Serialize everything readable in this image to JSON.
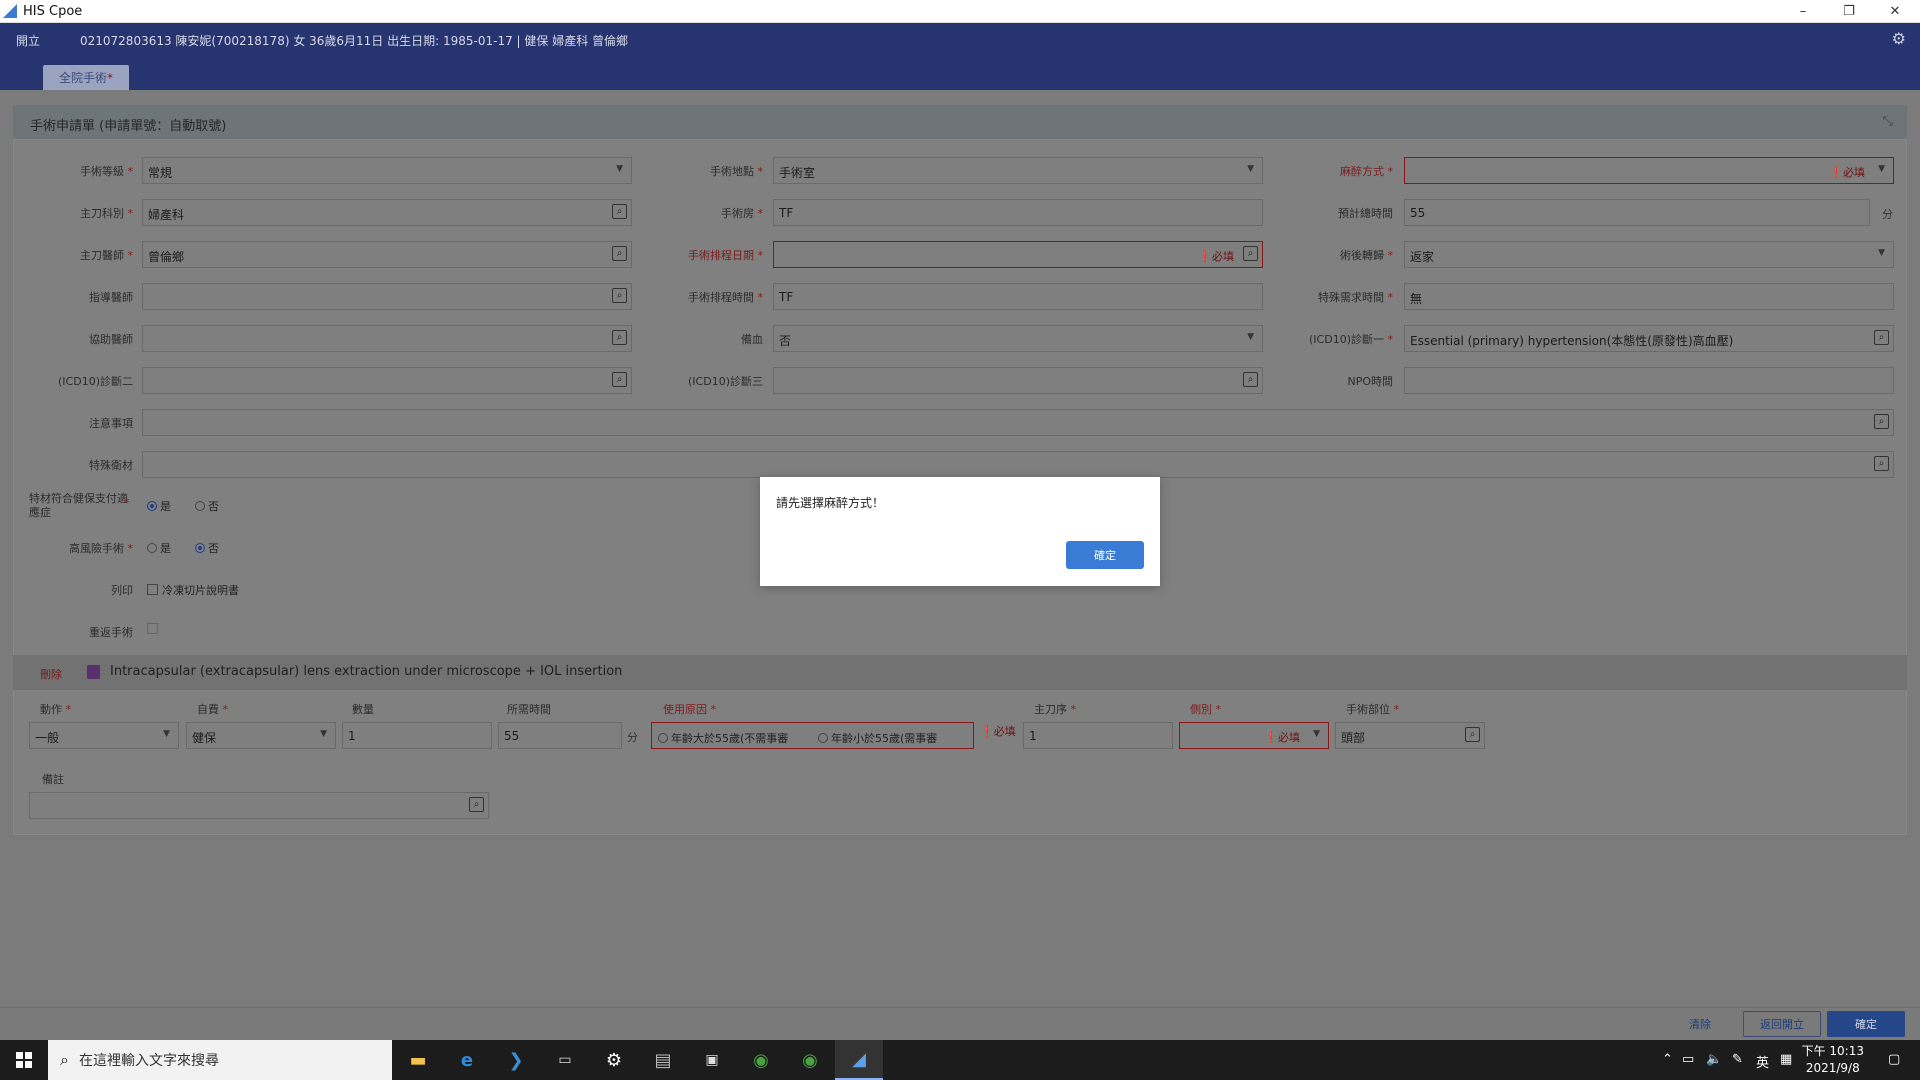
{
  "window": {
    "title": "HIS Cpoe",
    "minimize": "–",
    "restore": "❐",
    "close": "✕"
  },
  "header": {
    "open_btn": "開立",
    "patient_info": "021072803613  陳安妮(700218178)  女  36歲6月11日  出生日期: 1985-01-17  |  健保  婦產科  曾倫鄉",
    "tab_label": "全院手術",
    "tab_mark": "*"
  },
  "panel": {
    "title": "手術申請單 (申請單號：自動取號)",
    "must": "必填",
    "fields": {
      "grade": {
        "label": "手術等級",
        "value": "常規"
      },
      "place": {
        "label": "手術地點",
        "value": "手術室"
      },
      "anesthesia": {
        "label": "麻醉方式",
        "value": ""
      },
      "dept": {
        "label": "主刀科別",
        "value": "婦產科"
      },
      "room": {
        "label": "手術房",
        "value": "TF"
      },
      "est_time": {
        "label": "預計總時間",
        "value": "55",
        "unit": "分"
      },
      "doctor": {
        "label": "主刀醫師",
        "value": "曾倫鄉"
      },
      "sched_date": {
        "label": "手術排程日期",
        "value": ""
      },
      "postop": {
        "label": "術後轉歸",
        "value": "返家"
      },
      "assist1": {
        "label": "指導醫師",
        "value": ""
      },
      "sched_time": {
        "label": "手術排程時間",
        "value": "TF"
      },
      "special_time": {
        "label": "特殊需求時間",
        "value": "無"
      },
      "assist2": {
        "label": "協助醫師",
        "value": ""
      },
      "blood": {
        "label": "備血",
        "value": "否"
      },
      "icd1": {
        "label": "(ICD10)診斷一",
        "value": "Essential (primary) hypertension(本態性(原發性)高血壓)"
      },
      "icd2": {
        "label": "(ICD10)診斷二",
        "value": ""
      },
      "icd3": {
        "label": "(ICD10)診斷三",
        "value": ""
      },
      "npo": {
        "label": "NPO時間",
        "value": ""
      },
      "notes": {
        "label": "注意事項",
        "value": ""
      },
      "material": {
        "label": "特殊衛材",
        "value": ""
      },
      "insurance": {
        "label": "特材符合健保支付適應症",
        "yes": "是",
        "no": "否"
      },
      "high_risk": {
        "label": "高風險手術",
        "yes": "是",
        "no": "否"
      },
      "print": {
        "label": "列印",
        "option": "冷凍切片說明書"
      },
      "redo": {
        "label": "重返手術"
      }
    }
  },
  "procedure": {
    "delete": "刪除",
    "name": "Intracapsular (extracapsular) lens extraction under microscope + IOL insertion",
    "cols": {
      "action": {
        "label": "動作",
        "value": "一般"
      },
      "payer": {
        "label": "自費",
        "value": "健保"
      },
      "qty": {
        "label": "數量",
        "value": "1"
      },
      "time": {
        "label": "所需時間",
        "value": "55",
        "unit": "分"
      },
      "reason": {
        "label": "使用原因",
        "opt1": "年齡大於55歲(不需事審",
        "opt2": "年齡小於55歲(需事審"
      },
      "order": {
        "label": "主刀序",
        "value": "1"
      },
      "side": {
        "label": "側別",
        "value": ""
      },
      "site": {
        "label": "手術部位",
        "value": "頭部"
      },
      "remark": {
        "label": "備註",
        "value": ""
      }
    }
  },
  "footer": {
    "clear": "清除",
    "back": "返回開立",
    "confirm": "確定"
  },
  "dialog": {
    "message": "請先選擇麻醉方式！",
    "ok": "確定"
  },
  "taskbar": {
    "search_placeholder": "在這裡輸入文字來搜尋",
    "ime": "英",
    "time": "下午 10:13",
    "date": "2021/9/8"
  },
  "colors": {
    "header": "#26346f",
    "accent": "#3a7bd5",
    "error": "#8c1616"
  }
}
